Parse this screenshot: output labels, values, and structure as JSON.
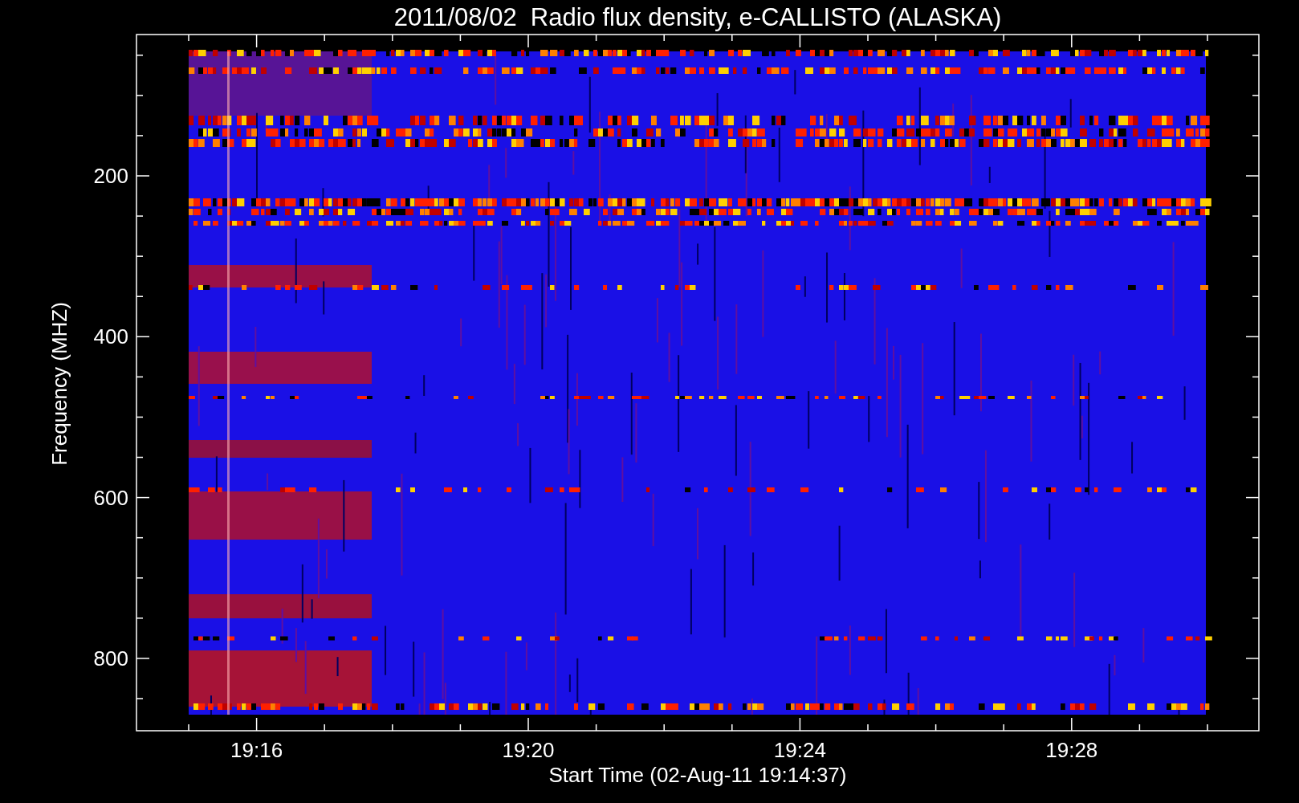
{
  "title": "2011/08/02  Radio flux density, e-CALLISTO (ALASKA)",
  "plot": {
    "xlabel": "Start Time (02-Aug-11 19:14:37)",
    "ylabel": "Frequency (MHZ)",
    "xtick_labels": [
      "19:16",
      "19:20",
      "19:24",
      "19:28"
    ],
    "ytick_labels": [
      "200",
      "400",
      "600",
      "800"
    ]
  }
}
